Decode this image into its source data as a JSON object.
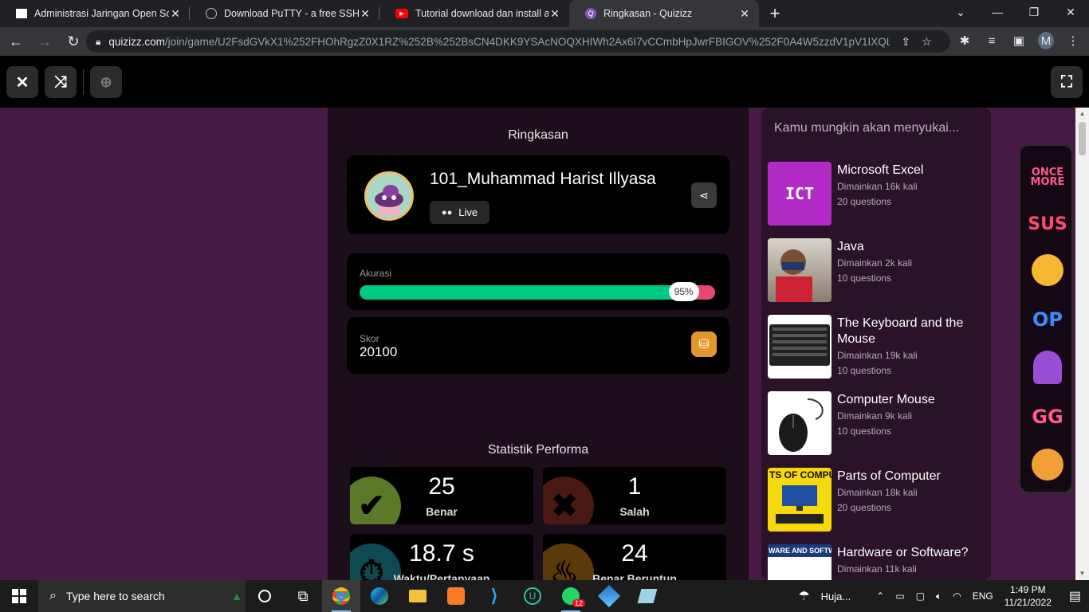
{
  "tabs": [
    {
      "title": "Administrasi Jaringan Open Source",
      "icon": "page-icon",
      "active": false
    },
    {
      "title": "Download PuTTY - a free SSH and",
      "icon": "globe-icon",
      "active": false
    },
    {
      "title": "Tutorial download dan install aplikasi",
      "icon": "youtube-icon",
      "active": false
    },
    {
      "title": "Ringkasan - Quizizz",
      "icon": "quizizz-icon",
      "active": true
    }
  ],
  "toolbar": {
    "url_host": "quizizz.com",
    "url_path": "/join/game/U2FsdGVkX1%252FHOhRgzZ0X1RZ%252B%252BsCN4DKK9YSAcNOQXHIWh2Ax6I7vCCmbHpJwrFBIGOV%252F0A4W5zzdV1pV1IXQL...",
    "profile_initial": "M"
  },
  "summary": {
    "title": "Ringkasan",
    "player_name": "101_Muhammad Harist Illyasa",
    "mode_badge": "Live",
    "accuracy_label": "Akurasi",
    "accuracy_percent": 95,
    "accuracy_text": "95%",
    "score_label": "Skor",
    "score_value": "20100"
  },
  "performance": {
    "title": "Statistik Performa",
    "stats": [
      {
        "value": "25",
        "label": "Benar",
        "color": "#00c985"
      },
      {
        "value": "1",
        "label": "Salah",
        "color": "#e54771"
      },
      {
        "value": "18.7 s",
        "label": "Waktu/Pertanyaan",
        "color": "#19b0c2"
      },
      {
        "value": "24",
        "label": "Benar Beruntun",
        "color": "#e0982c"
      }
    ]
  },
  "recommendations": {
    "header": "Kamu mungkin akan menyukai...",
    "items": [
      {
        "title": "Microsoft Excel",
        "plays": "Dimainkan 16k kali",
        "questions": "20 questions",
        "thumb_text": "ICT"
      },
      {
        "title": "Java",
        "plays": "Dimainkan 2k kali",
        "questions": "10 questions",
        "thumb_text": ""
      },
      {
        "title": "The Keyboard and the Mouse",
        "plays": "Dimainkan 19k kali",
        "questions": "10 questions",
        "thumb_text": ""
      },
      {
        "title": "Computer Mouse",
        "plays": "Dimainkan 9k kali",
        "questions": "10 questions",
        "thumb_text": ""
      },
      {
        "title": "Parts of Computer",
        "plays": "Dimainkan 18k kali",
        "questions": "20 questions",
        "thumb_text": "TS OF COMPU"
      },
      {
        "title": "Hardware or Software?",
        "plays": "Dimainkan 11k kali",
        "questions": "",
        "thumb_text": "WARE AND SOFTW"
      }
    ]
  },
  "stickers": [
    "ONCE MORE",
    "SUS",
    "",
    "OP",
    "",
    "GG",
    ""
  ],
  "taskbar": {
    "search_placeholder": "Type here to search",
    "weather": "Huja...",
    "language": "ENG",
    "time": "1:49 PM",
    "date": "11/21/2022",
    "whatsapp_badge": "12"
  }
}
